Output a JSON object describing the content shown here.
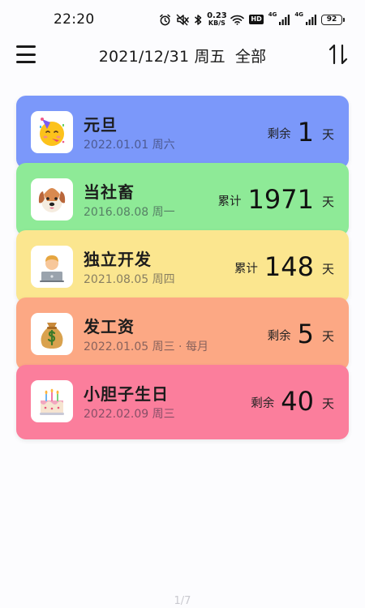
{
  "status_bar": {
    "time": "22:20",
    "net_speed_value": "0.23",
    "net_speed_unit": "KB/S",
    "hd_label": "HD",
    "signal1_label": "4G",
    "signal2_label": "4G",
    "battery": "92"
  },
  "header": {
    "date": "2021/12/31 周五",
    "filter": "全部"
  },
  "cards": [
    {
      "title": "元旦",
      "date": "2022.01.01 周六",
      "count_label": "剩余",
      "count": "1",
      "unit": "天",
      "color": "#7b98fa",
      "icon": "party-face-icon"
    },
    {
      "title": "当社畜",
      "date": "2016.08.08 周一",
      "count_label": "累计",
      "count": "1971",
      "unit": "天",
      "color": "#8eea97",
      "icon": "dog-face-icon"
    },
    {
      "title": "独立开发",
      "date": "2021.08.05 周四",
      "count_label": "累计",
      "count": "148",
      "unit": "天",
      "color": "#fbe68f",
      "icon": "developer-laptop-icon"
    },
    {
      "title": "发工资",
      "date": "2022.01.05 周三 · 每月",
      "count_label": "剩余",
      "count": "5",
      "unit": "天",
      "color": "#fca884",
      "icon": "money-bag-icon"
    },
    {
      "title": "小胆子生日",
      "date": "2022.02.09 周三",
      "count_label": "剩余",
      "count": "40",
      "unit": "天",
      "color": "#fb7e9c",
      "icon": "birthday-cake-icon"
    }
  ],
  "page_indicator": "1/7"
}
